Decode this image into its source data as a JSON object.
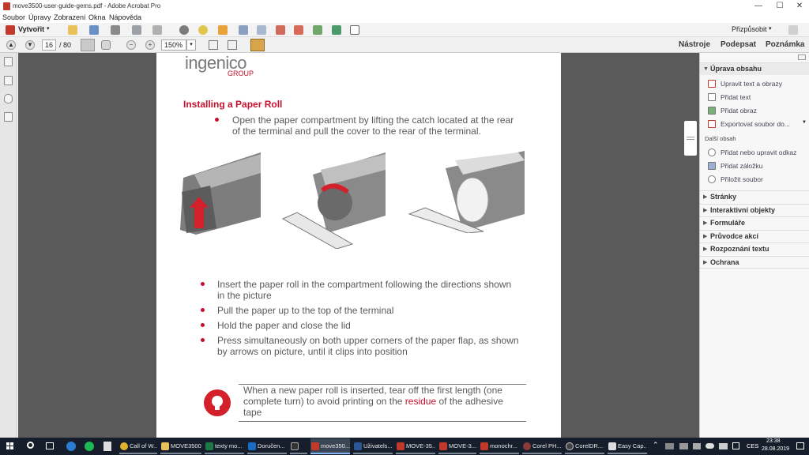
{
  "window": {
    "title": "move3500-user-guide-gems.pdf - Adobe Acrobat Pro"
  },
  "menu": [
    "Soubor",
    "Úpravy",
    "Zobrazení",
    "Okna",
    "Nápověda"
  ],
  "toolbar": {
    "create_label": "Vytvořit",
    "customize_label": "Přizpůsobit"
  },
  "nav": {
    "page_current": "16",
    "page_total": "/ 80",
    "zoom": "150%",
    "tools_label": "Nástroje",
    "sign_label": "Podepsat",
    "comment_label": "Poznámka"
  },
  "document": {
    "logo_text": "ingenico",
    "logo_sub": "GROUP",
    "heading": "Installing a Paper Roll",
    "intro_lines": [
      "Open the paper compartment by lifting the catch located at the rear",
      "of the terminal and pull the cover to the rear of the terminal."
    ],
    "bullets": [
      {
        "lines": [
          "Insert the paper roll in the compartment following the directions shown",
          "in the picture"
        ]
      },
      {
        "lines": [
          "Pull the paper up to the top of the terminal"
        ]
      },
      {
        "lines": [
          "Hold the paper and close the lid"
        ]
      },
      {
        "lines": [
          "Press simultaneously on both upper corners of the paper flap, as shown",
          "by arrows on picture, until it clips into position"
        ]
      }
    ],
    "note": {
      "line1": "When a new paper roll is inserted, tear off the first length (one",
      "line2": "complete turn) to avoid printing on the",
      "highlight": "residue",
      "line2_end": "of the adhesive",
      "line3": "tape"
    }
  },
  "right_panel": {
    "edit_section": "Úprava obsahu",
    "edit_items": [
      "Upravit text a obrazy",
      "Přidat text",
      "Přidat obraz",
      "Exportovat soubor do..."
    ],
    "other_title": "Další obsah",
    "other_items": [
      "Přidat nebo upravit odkaz",
      "Přidat záložku",
      "Přiložit soubor"
    ],
    "sections": [
      "Stránky",
      "Interaktivní objekty",
      "Formuláře",
      "Průvodce akcí",
      "Rozpoznání textu",
      "Ochrana"
    ]
  },
  "taskbar": {
    "items": [
      "Call of W...",
      "MOVE3500",
      "texty mo...",
      "Doručen...",
      "",
      "move350...",
      "Uživatels...",
      "MOVE-35...",
      "MOVE-3...",
      "monochr...",
      "Corel PH...",
      "CorelDR...",
      "Easy Cap..."
    ],
    "lang": "CES",
    "time": "23:38",
    "date": "28.08.2019"
  },
  "colors": {
    "accent_red": "#c8102e",
    "acrobat_red": "#c0392b",
    "taskbar": "#151e2a"
  }
}
